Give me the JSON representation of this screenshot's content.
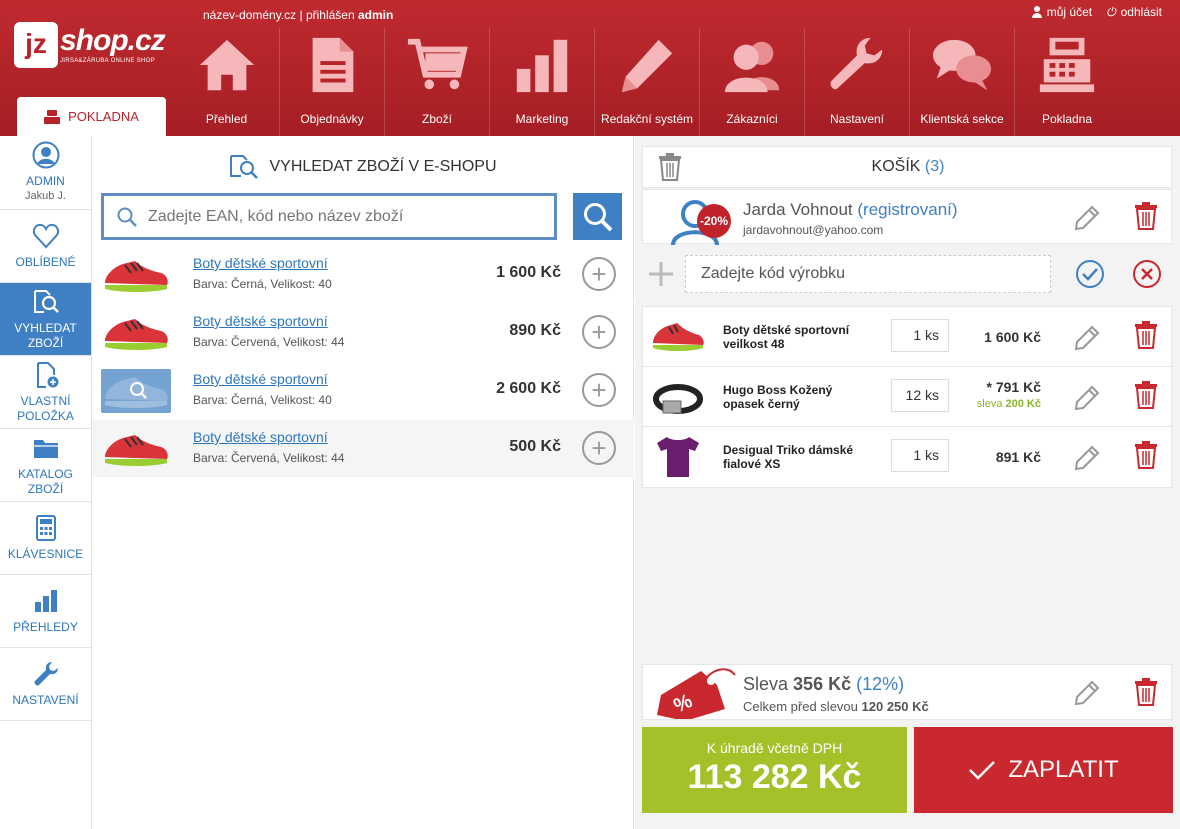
{
  "header": {
    "logo_text": "jz shop.cz",
    "logo_sub": "JIRSA&ZÁRUBA ONLINE SHOP",
    "domain": "název-domény.cz",
    "separator": " | přihlášen ",
    "user": "admin",
    "my_account": "můj účet",
    "logout": "odhlásit",
    "active_tab": "POKLADNA",
    "nav": [
      {
        "label": "Přehled",
        "icon": "home-icon"
      },
      {
        "label": "Objednávky",
        "icon": "document-icon"
      },
      {
        "label": "Zboží",
        "icon": "cart-icon"
      },
      {
        "label": "Marketing",
        "icon": "bar-chart-icon"
      },
      {
        "label": "Redakční systém",
        "icon": "pencil-icon"
      },
      {
        "label": "Zákazníci",
        "icon": "users-icon"
      },
      {
        "label": "Nastavení",
        "icon": "wrench-icon"
      },
      {
        "label": "Klientská sekce",
        "icon": "chat-bubbles-icon"
      },
      {
        "label": "Pokladna",
        "icon": "cash-register-icon"
      }
    ]
  },
  "sidebar": {
    "admin_label": "ADMIN",
    "admin_name": "Jakub J.",
    "items": [
      {
        "line1": "OBLÍBENÉ",
        "line2": ""
      },
      {
        "line1": "VYHLEDAT",
        "line2": "ZBOŽÍ"
      },
      {
        "line1": "VLASTNÍ",
        "line2": "POLOŽKA"
      },
      {
        "line1": "KATALOG",
        "line2": "ZBOŽÍ"
      },
      {
        "line1": "KLÁVESNICE",
        "line2": ""
      },
      {
        "line1": "PŘEHLEDY",
        "line2": ""
      },
      {
        "line1": "NASTAVENÍ",
        "line2": ""
      }
    ]
  },
  "search": {
    "title": "VYHLEDAT ZBOŽÍ V E-SHOPU",
    "placeholder": "Zadejte EAN, kód nebo název zboží",
    "results": [
      {
        "name": "Boty dětské sportovní",
        "attr": "Barva: Černá, Velikost: 40",
        "price": "1 600 Kč"
      },
      {
        "name": "Boty dětské sportovní",
        "attr": "Barva: Červená, Velikost: 44",
        "price": "890 Kč"
      },
      {
        "name": "Boty dětské sportovní",
        "attr": "Barva: Černá, Velikost: 40",
        "price": "2 600 Kč"
      },
      {
        "name": "Boty dětské sportovní",
        "attr": "Barva: Červená, Velikost: 44",
        "price": "500 Kč"
      }
    ]
  },
  "cart": {
    "title": "KOŠÍK",
    "count": "(3)",
    "customer": {
      "name": "Jarda Vohnout",
      "status": "(registrovaní)",
      "email": "jardavohnout@yahoo.com",
      "discount_badge": "-20%"
    },
    "code_placeholder": "Zadejte kód výrobku",
    "items": [
      {
        "name": "Boty dětské sportovní veilkost 48",
        "qty": "1 ks",
        "price": "1 600 Kč",
        "discount_label": "",
        "discount_value": ""
      },
      {
        "name": "Hugo Boss Kožený opasek černý",
        "qty": "12 ks",
        "price": "* 791 Kč",
        "discount_label": "sleva",
        "discount_value": "200 Kč"
      },
      {
        "name": "Desigual Triko dámské fialové XS",
        "qty": "1 ks",
        "price": "891 Kč",
        "discount_label": "",
        "discount_value": ""
      }
    ],
    "discount": {
      "label": "Sleva",
      "amount": "356 Kč",
      "percent": "(12%)",
      "before_label": "Celkem před slevou",
      "before_amount": "120 250 Kč"
    },
    "total_label": "K úhradě včetně DPH",
    "total_amount": "113 282 Kč",
    "pay_label": "ZAPLATIT"
  },
  "colors": {
    "brand_red": "#b8232a",
    "accent_blue": "#3f7fc3",
    "pay_green": "#a4c12a"
  }
}
